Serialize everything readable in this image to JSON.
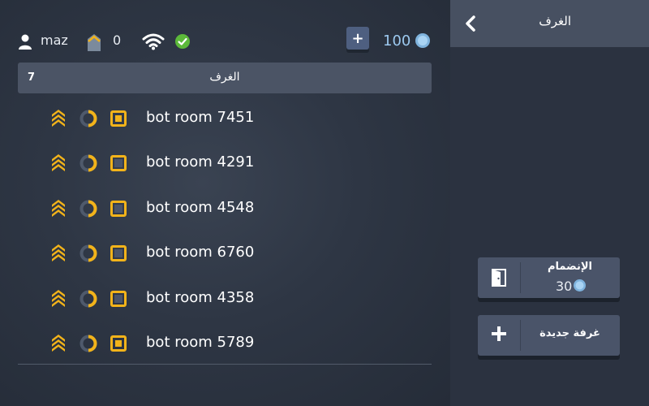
{
  "header": {
    "title": "الغرف"
  },
  "status": {
    "username": "maz",
    "rank_value": "0",
    "coins": "100",
    "add_coins_label": "+"
  },
  "rooms": {
    "header_title": "الغرف",
    "count": "7",
    "items": [
      {
        "name": "bot room 7451",
        "square_filled": true
      },
      {
        "name": "bot room 4291",
        "square_filled": false
      },
      {
        "name": "bot room 4548",
        "square_filled": false
      },
      {
        "name": "bot room 6760",
        "square_filled": false
      },
      {
        "name": "bot room 4358",
        "square_filled": false
      },
      {
        "name": "bot room 5789",
        "square_filled": true
      }
    ]
  },
  "actions": {
    "join_label": "الإنضمام",
    "join_cost": "30",
    "new_room_label": "غرفة جديدة"
  },
  "colors": {
    "accent_yellow": "#f2b31a",
    "coin_blue": "#9cc9ef",
    "online_green": "#5cb93a",
    "button_bg": "#4a5469"
  },
  "icons": {
    "user": "user-icon",
    "rank": "rank-badge-icon",
    "wifi": "wifi-icon",
    "check": "check-icon",
    "coin": "coin-icon",
    "back": "chevron-left-icon",
    "room_rank": "chevron-rank-icon",
    "room_ring": "ring-icon",
    "room_square": "square-icon",
    "door": "door-icon",
    "plus": "plus-icon"
  }
}
